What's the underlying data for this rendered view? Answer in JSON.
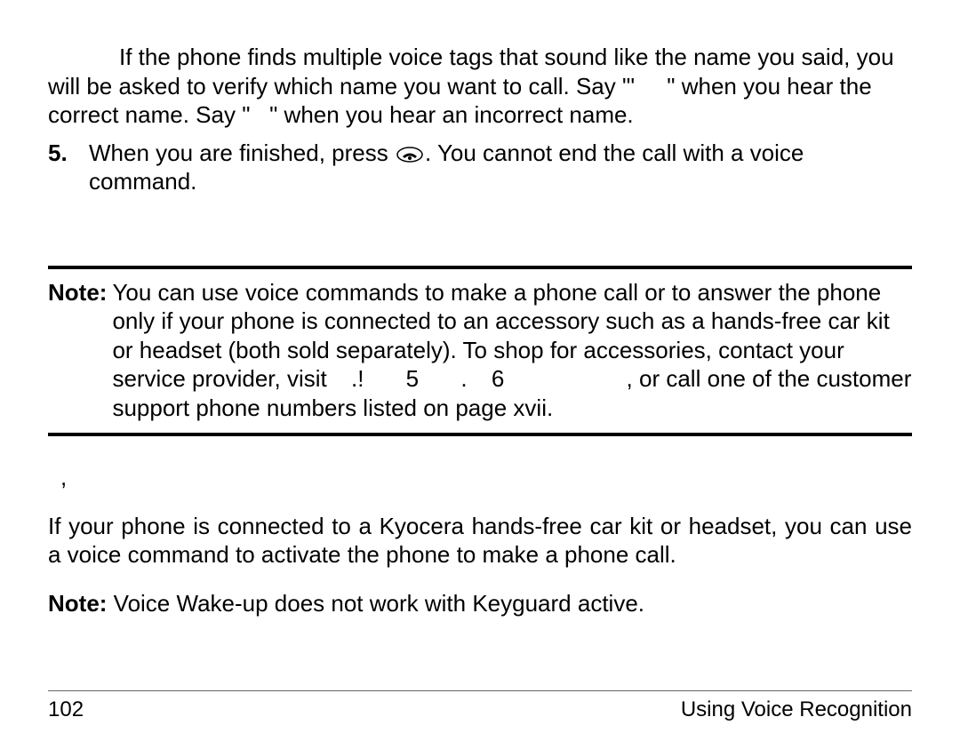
{
  "para1": {
    "text": "If the phone finds multiple voice tags that sound like the name you said, you will be asked to verify which name you want to call. Say \"'     \" when you hear the correct name. Say \"   \" when you hear an incorrect name."
  },
  "item5": {
    "num": "5.",
    "textBefore": "When you are finished, press ",
    "textAfter": ". You cannot end the call with a voice command."
  },
  "noteBlock": {
    "label": "Note:",
    "part1": "You can use voice commands to make a phone call or to answer the phone only if your phone is connected to an accessory such as a hands-free car kit or headset (both sold separately). To shop for accessories, contact your service provider, visit",
    "c1": ".!",
    "c2": "5",
    "c3": ".",
    "c4": "6",
    "part2": ", or call one of the customer support phone numbers listed on page xvii."
  },
  "smallMark": ",",
  "para2": "If your phone is connected to a Kyocera hands-free car kit or headset, you can use a voice command to activate the phone to make a phone call.",
  "note2": {
    "label": "Note:",
    "text": " Voice Wake-up does not work with Keyguard active."
  },
  "footer": {
    "pageNum": "102",
    "chapter": "Using Voice Recognition"
  }
}
